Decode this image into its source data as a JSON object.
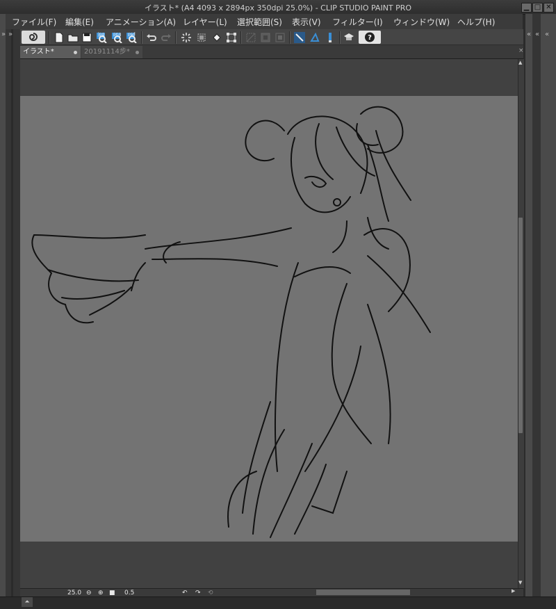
{
  "window": {
    "title": "イラスト* (A4 4093 x 2894px 350dpi 25.0%)  - CLIP STUDIO PAINT PRO",
    "minimize": "▁",
    "maximize": "□",
    "close": "✕"
  },
  "menu": {
    "file": "ファイル(F)",
    "edit": "編集(E)",
    "animation": "アニメーション(A)",
    "layer": "レイヤー(L)",
    "selection": "選択範囲(S)",
    "view": "表示(V)",
    "filter": "フィルター(I)",
    "window": "ウィンドウ(W)",
    "help": "ヘルプ(H)"
  },
  "rails": {
    "left_chevron": "»",
    "right_chevron": "«"
  },
  "toolbar": {
    "export_labels": [
      "jpg",
      "png",
      "psd"
    ]
  },
  "tabs": [
    {
      "label": "イラスト*",
      "active": true
    },
    {
      "label": "20191114步*",
      "active": false
    }
  ],
  "status": {
    "zoom": "25.0",
    "angle": "0.5"
  },
  "colors": {
    "paper": "#737373",
    "workarea": "#414141",
    "accent": "#3a8fd6"
  }
}
